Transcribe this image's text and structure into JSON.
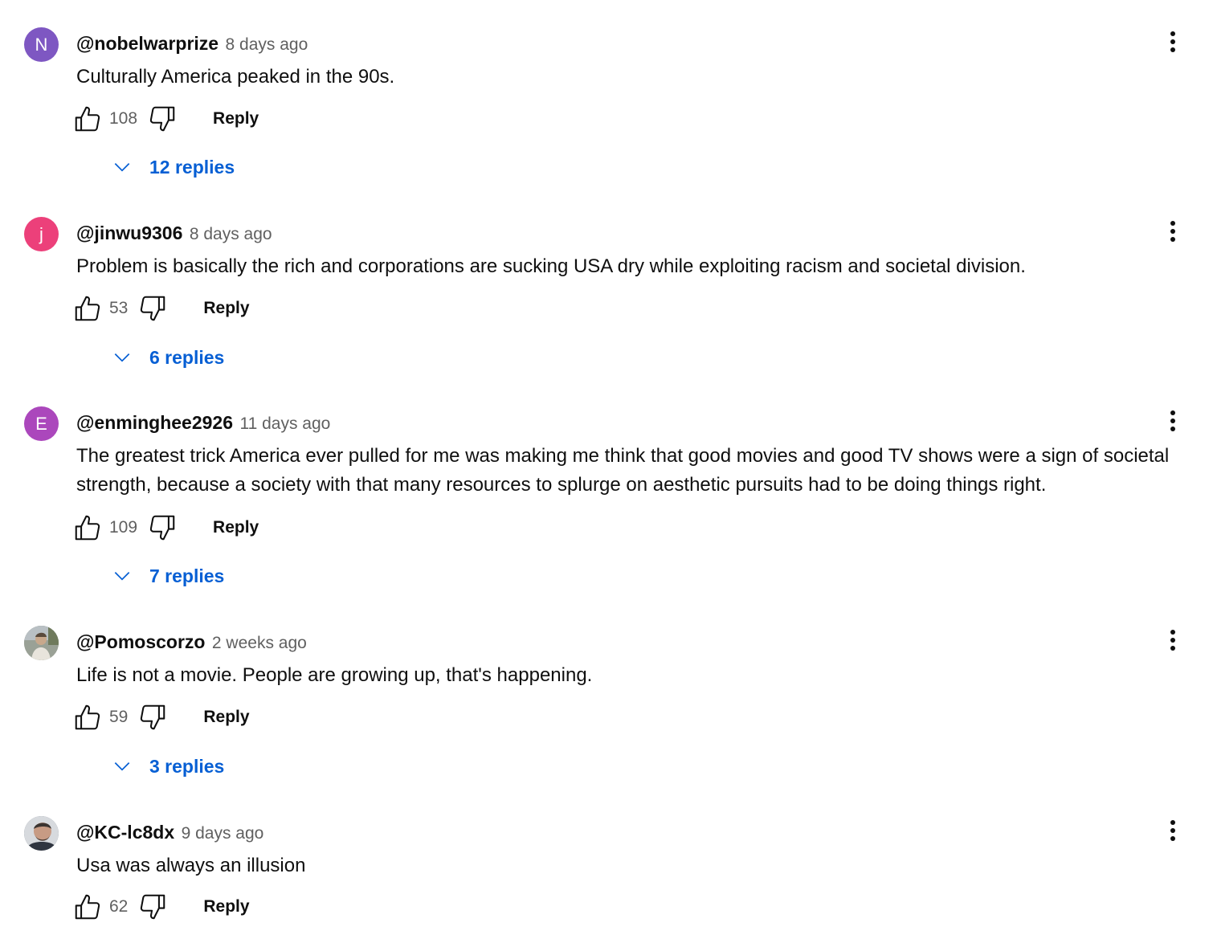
{
  "comments": [
    {
      "author": "@nobelwarprize",
      "time": "8 days ago",
      "text": "Culturally America peaked in the 90s.",
      "likes": "108",
      "reply_label": "Reply",
      "replies_label": "12 replies",
      "avatar": {
        "letter": "N",
        "color": "#7e57c2"
      }
    },
    {
      "author": "@jinwu9306",
      "time": "8 days ago",
      "text": "Problem is basically the rich and corporations are sucking USA dry while exploiting racism and societal division.",
      "likes": "53",
      "reply_label": "Reply",
      "replies_label": "6 replies",
      "avatar": {
        "letter": "j",
        "color": "#ec407a"
      }
    },
    {
      "author": "@enminghee2926",
      "time": "11 days ago",
      "text": "The greatest trick America ever pulled for me was making me think that good movies and good TV shows were a sign of societal strength, because a society with that many resources to splurge on aesthetic pursuits had to be doing things right.",
      "likes": "109",
      "reply_label": "Reply",
      "replies_label": "7 replies",
      "avatar": {
        "letter": "E",
        "color": "#ab47bc"
      }
    },
    {
      "author": "@Pomoscorzo",
      "time": "2 weeks ago",
      "text": "Life is not a movie. People are growing up, that's happening.",
      "likes": "59",
      "reply_label": "Reply",
      "replies_label": "3 replies",
      "avatar": {
        "letter": "",
        "color": "#8a8f86"
      }
    },
    {
      "author": "@KC-lc8dx",
      "time": "9 days ago",
      "text": "Usa was always an illusion",
      "likes": "62",
      "reply_label": "Reply",
      "replies_label": "",
      "avatar": {
        "letter": "",
        "color": "#6b7480"
      }
    }
  ]
}
